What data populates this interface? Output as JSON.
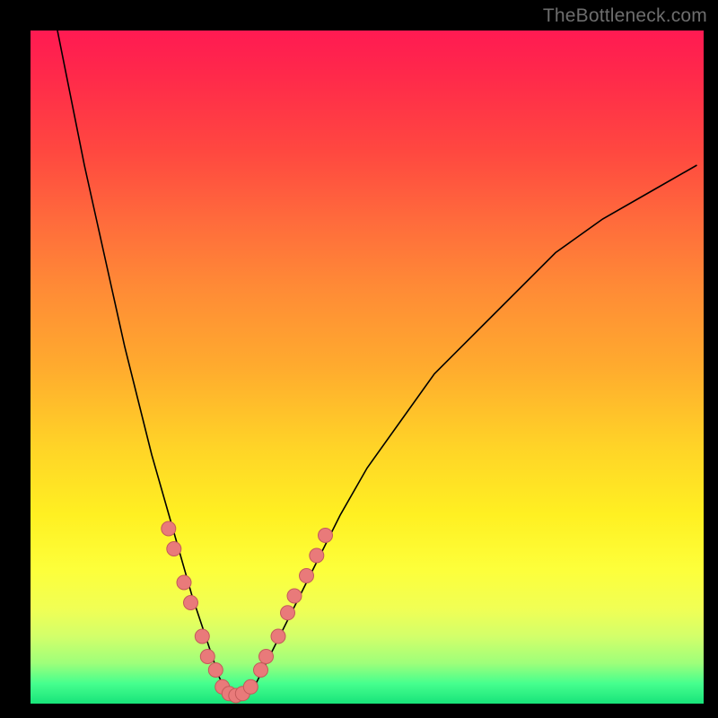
{
  "watermark": {
    "text": "TheBottleneck.com"
  },
  "colors": {
    "frame": "#000000",
    "curve": "#000000",
    "dot_fill": "#e97a7a",
    "dot_stroke": "#c45a5a",
    "gradient_top": "#ff1a52",
    "gradient_bottom": "#18e47a"
  },
  "chart_data": {
    "type": "line",
    "title": "",
    "xlabel": "",
    "ylabel": "",
    "xlim": [
      0,
      100
    ],
    "ylim": [
      0,
      100
    ],
    "grid": false,
    "series": [
      {
        "name": "bottleneck-curve",
        "x": [
          4,
          6,
          8,
          10,
          12,
          14,
          16,
          18,
          20,
          22,
          24,
          25,
          26,
          27,
          28,
          29,
          30,
          31,
          33,
          35,
          38,
          42,
          46,
          50,
          55,
          60,
          66,
          72,
          78,
          85,
          92,
          99
        ],
        "y": [
          100,
          90,
          80,
          71,
          62,
          53,
          45,
          37,
          30,
          23,
          16,
          13,
          10,
          7,
          4,
          2,
          1,
          1,
          2,
          6,
          12,
          20,
          28,
          35,
          42,
          49,
          55,
          61,
          67,
          72,
          76,
          80
        ]
      }
    ],
    "annotations": {
      "dots": [
        {
          "x": 20.5,
          "y": 26
        },
        {
          "x": 21.3,
          "y": 23
        },
        {
          "x": 22.8,
          "y": 18
        },
        {
          "x": 23.8,
          "y": 15
        },
        {
          "x": 25.5,
          "y": 10
        },
        {
          "x": 26.3,
          "y": 7
        },
        {
          "x": 27.5,
          "y": 5
        },
        {
          "x": 28.5,
          "y": 2.5
        },
        {
          "x": 29.5,
          "y": 1.5
        },
        {
          "x": 30.5,
          "y": 1.2
        },
        {
          "x": 31.5,
          "y": 1.5
        },
        {
          "x": 32.7,
          "y": 2.5
        },
        {
          "x": 34.2,
          "y": 5
        },
        {
          "x": 35.0,
          "y": 7
        },
        {
          "x": 36.8,
          "y": 10
        },
        {
          "x": 38.2,
          "y": 13.5
        },
        {
          "x": 39.2,
          "y": 16
        },
        {
          "x": 41.0,
          "y": 19
        },
        {
          "x": 42.5,
          "y": 22
        },
        {
          "x": 43.8,
          "y": 25
        }
      ]
    }
  }
}
